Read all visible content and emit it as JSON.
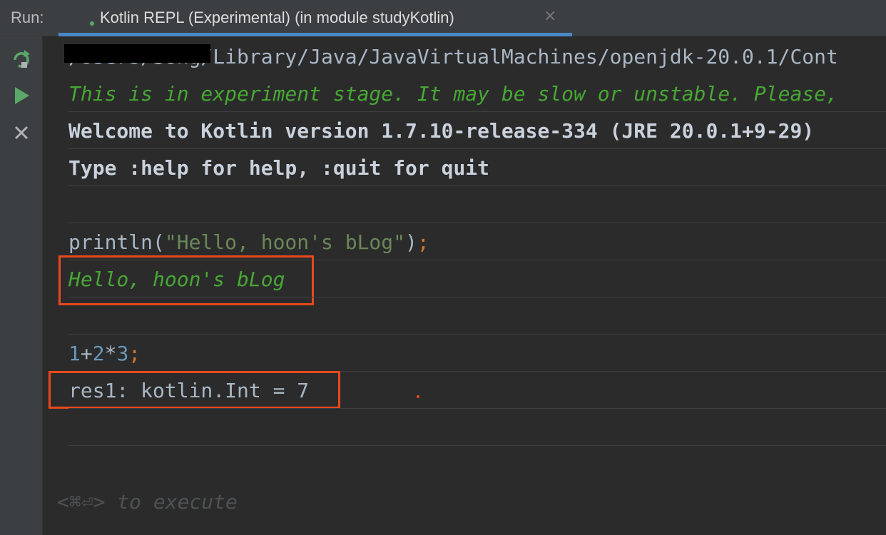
{
  "tabbar": {
    "run_label": "Run:",
    "tab_title": "Kotlin REPL (Experimental) (in module studyKotlin)",
    "close_glyph": "×"
  },
  "toolbar": {
    "buttons": [
      {
        "name": "rerun-icon"
      },
      {
        "name": "run-icon"
      },
      {
        "name": "stop-icon"
      }
    ]
  },
  "console": {
    "path_line": "/Users/Song/Library/Java/JavaVirtualMachines/openjdk-20.0.1/Cont",
    "warning_line": "This is in experiment stage. It may be slow or unstable. Please,",
    "welcome_line": "Welcome to Kotlin version 1.7.10-release-334 (JRE 20.0.1+9-29)",
    "help_line": "Type :help for help, :quit for quit",
    "input1": {
      "fn": "println(",
      "str": "\"Hello, hoon's bLog\"",
      "close": ")",
      "semi": ";"
    },
    "output1": "Hello, hoon's bLog",
    "input2": {
      "n1": "1",
      "op1": "+",
      "n2": "2",
      "op2": "*",
      "n3": "3",
      "semi": ";"
    },
    "output2": "res1: kotlin.Int = 7",
    "prompt_hint": "<⌘⏎> to execute"
  },
  "colors": {
    "accent_tab_underline": "#4a88c7",
    "highlight_box": "#e8491d",
    "output_green": "#47a834"
  }
}
